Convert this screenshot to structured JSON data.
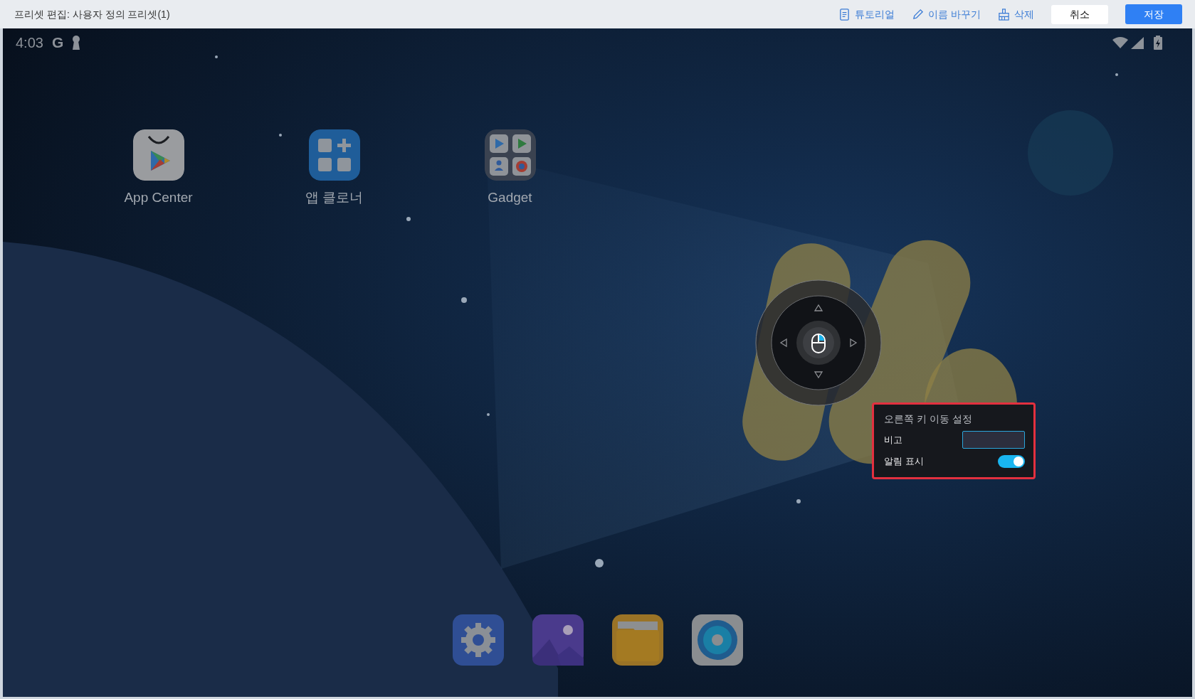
{
  "window": {
    "title": "프리셋 편집: 사용자 정의 프리셋(1)"
  },
  "toolbar": [
    {
      "kind": "link",
      "label": "튜토리얼"
    },
    {
      "kind": "link",
      "label": "이름 바꾸기"
    },
    {
      "kind": "link",
      "label": "삭제"
    },
    {
      "kind": "secondary",
      "label": "취소"
    },
    {
      "kind": "primary",
      "label": "저장"
    }
  ],
  "status_bar": {
    "time": "4:03",
    "carrier": "G"
  },
  "apps": [
    {
      "label": "App Center"
    },
    {
      "label": "앱 클로너"
    },
    {
      "label": "Gadget"
    }
  ],
  "key_panel": {
    "title": "오른쪽 키 이동 설정",
    "fields": [
      {
        "kind": "input",
        "label": "비고"
      },
      {
        "kind": "toggle",
        "label": "알림 표시",
        "on": true
      }
    ]
  }
}
